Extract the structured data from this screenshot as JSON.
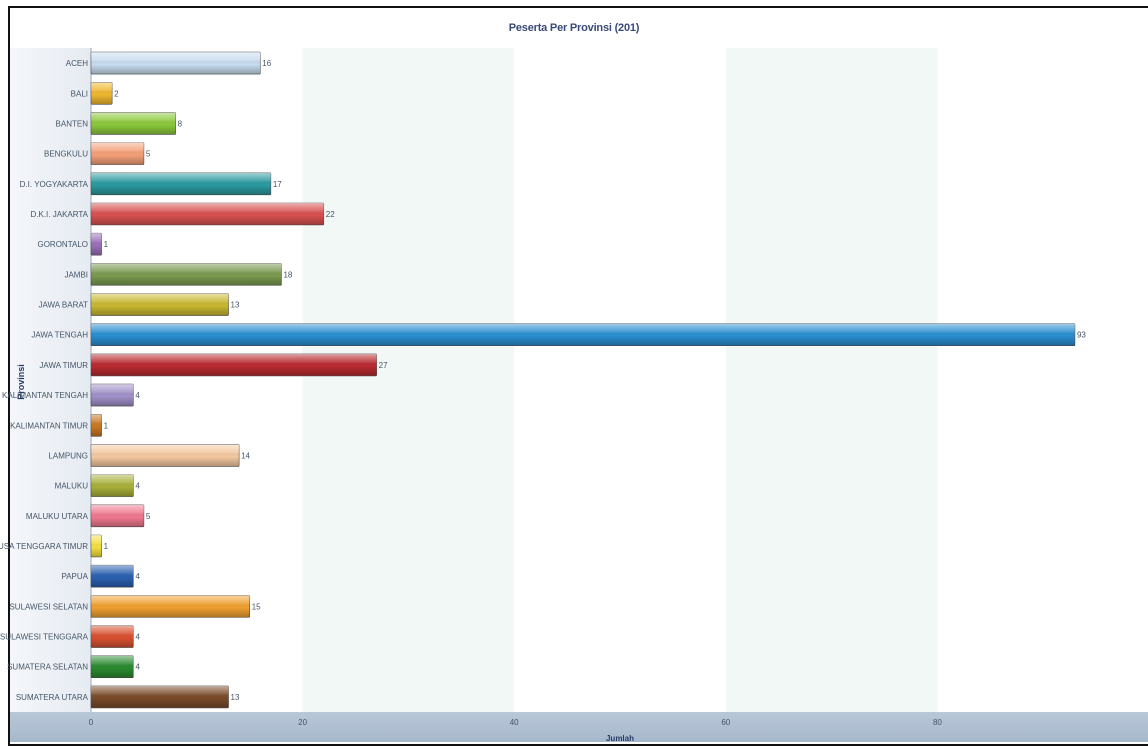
{
  "chart_data": {
    "type": "bar",
    "orientation": "horizontal",
    "title": "Peserta Per Provinsi (201)",
    "xlabel": "Jumlah",
    "ylabel": "Provinsi",
    "xlim": [
      0,
      100
    ],
    "xticks": [
      0,
      20,
      40,
      60,
      80,
      100
    ],
    "grid": "alternating vertical bands",
    "categories": [
      "ACEH",
      "BALI",
      "BANTEN",
      "BENGKULU",
      "D.I. YOGYAKARTA",
      "D.K.I. JAKARTA",
      "GORONTALO",
      "JAMBI",
      "JAWA BARAT",
      "JAWA TENGAH",
      "JAWA TIMUR",
      "KALIMANTAN TENGAH",
      "KALIMANTAN TIMUR",
      "LAMPUNG",
      "MALUKU",
      "MALUKU UTARA",
      "NUSA TENGGARA TIMUR",
      "PAPUA",
      "SULAWESI SELATAN",
      "SULAWESI TENGGARA",
      "SUMATERA SELATAN",
      "SUMATERA UTARA"
    ],
    "values": [
      16,
      2,
      8,
      5,
      17,
      22,
      1,
      18,
      13,
      93,
      27,
      4,
      1,
      14,
      4,
      5,
      1,
      4,
      15,
      4,
      4,
      13
    ],
    "colors": [
      "#c8ddf0",
      "#f0b830",
      "#8cc83c",
      "#f4a078",
      "#2a9aa0",
      "#d85050",
      "#9a70b8",
      "#7a9a50",
      "#c8b830",
      "#2a8ed0",
      "#b82a30",
      "#a090c8",
      "#c87820",
      "#f4c8a0",
      "#a8b038",
      "#f07890",
      "#f4e040",
      "#2a60b0",
      "#f0a030",
      "#d85030",
      "#2a8a30",
      "#7a4a28"
    ]
  }
}
